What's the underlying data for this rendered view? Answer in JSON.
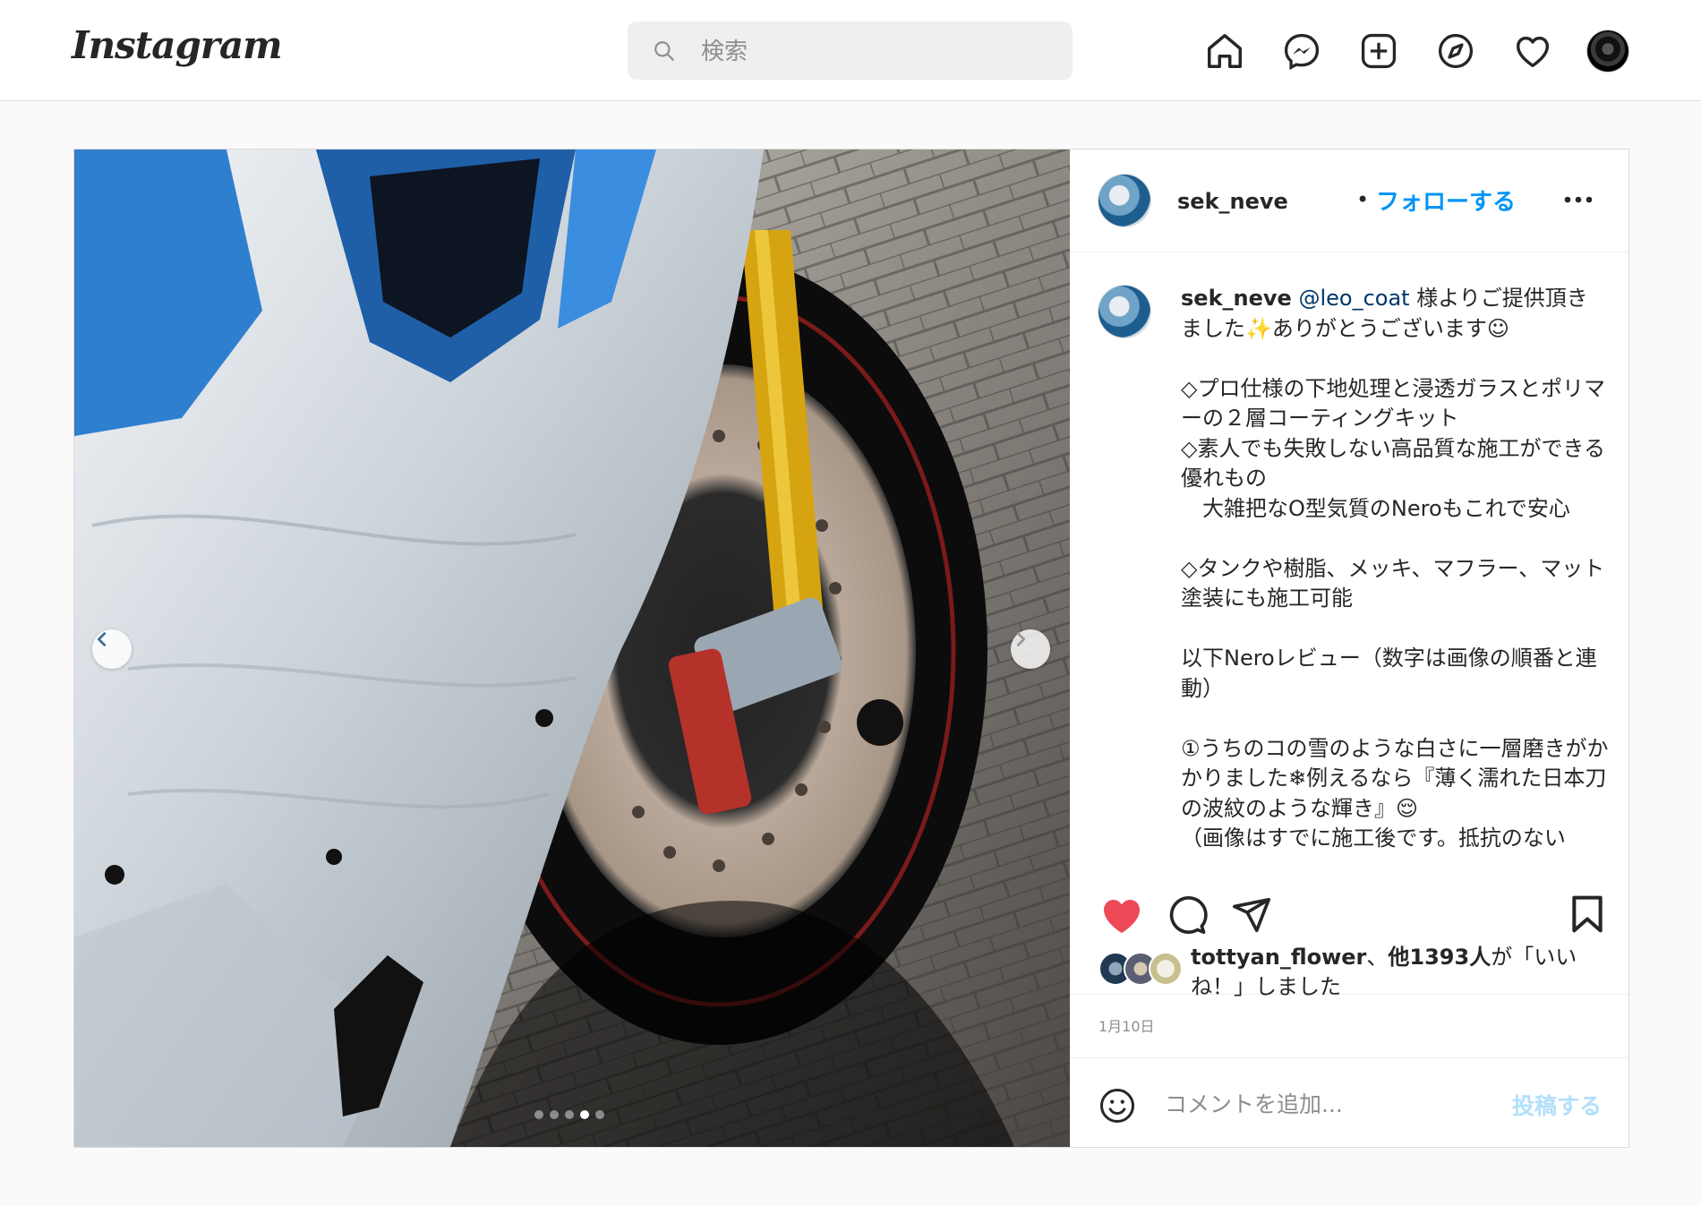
{
  "header": {
    "logo_text": "Instagram",
    "search": {
      "placeholder": "検索"
    },
    "nav": [
      {
        "icon": "home-icon"
      },
      {
        "icon": "messenger-icon"
      },
      {
        "icon": "new-post-icon"
      },
      {
        "icon": "explore-icon"
      },
      {
        "icon": "activity-heart-icon"
      },
      {
        "icon": "profile-avatar"
      }
    ]
  },
  "post": {
    "carousel": {
      "slide_count": 5,
      "active_slide": 4
    },
    "author": {
      "username": "sek_neve",
      "separator": "•",
      "follow_label": "フォローする"
    },
    "caption": {
      "username": "sek_neve",
      "mention": "@leo_coat",
      "text": " 様よりご提供頂きました✨ありがとうございます☺\n\n◇プロ仕様の下地処理と浸透ガラスとポリマーの２層コーティングキット\n◇素人でも失敗しない高品質な施工ができる優れもの\n　大雑把なO型気質のNeroもこれで安心\n\n◇タンクや樹脂、メッキ、マフラー、マット塗装にも施工可能\n\n以下Neroレビュー（数字は画像の順番と連動）\n\n①うちのコの雪のような白さに一層磨きがかかりました❄例えるなら『薄く濡れた日本刀の波紋のような輝き』😌\n（画像はすでに施工後です。抵抗のない"
    },
    "likes": {
      "first_liker": "tottyan_flower",
      "joiner": "、",
      "others": "他1393人",
      "suffix": "が「いいね！」しました"
    },
    "date": "1月10日",
    "comment": {
      "placeholder": "コメントを追加...",
      "post_label": "投稿する"
    }
  },
  "colors": {
    "accent_blue": "#0095f6",
    "like_red": "#ed4956",
    "post_disabled": "#b2dffc"
  }
}
